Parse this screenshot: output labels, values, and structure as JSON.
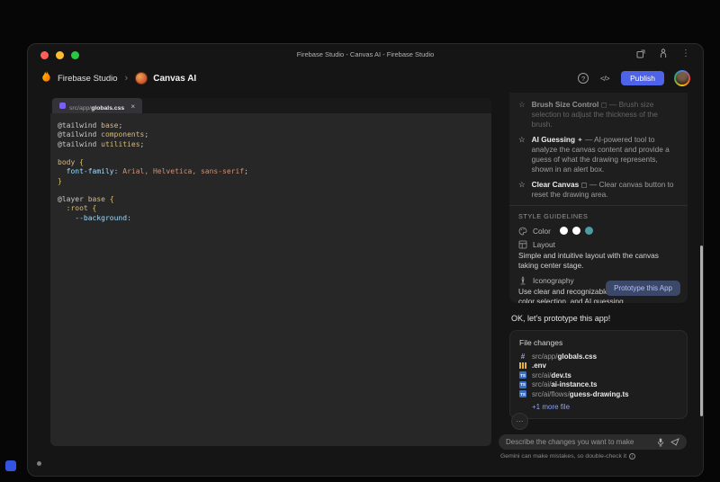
{
  "window": {
    "title": "Firebase Studio - Canvas AI - Firebase Studio",
    "traffic_lights": [
      "#ff5f57",
      "#febc2e",
      "#28c840"
    ]
  },
  "icons": {
    "chevron": "›",
    "kebab": "⋮",
    "help": "?",
    "code": "</>",
    "close": "×",
    "more": "⋯",
    "info": "i",
    "star": "☆"
  },
  "header": {
    "brand": "Firebase Studio",
    "app_name": "Canvas AI",
    "publish_label": "Publish",
    "accent_color": "#4e63e8"
  },
  "editor": {
    "tab": {
      "path": "src/app/",
      "file": "globals.css"
    },
    "code_lines": [
      [
        {
          "t": "@tailwind",
          "c": "#c8c8c8"
        },
        {
          "t": " base",
          "c": "#d7ba7d"
        },
        {
          "t": ";",
          "c": "#c8c8c8"
        }
      ],
      [
        {
          "t": "@tailwind",
          "c": "#c8c8c8"
        },
        {
          "t": " components",
          "c": "#d7ba7d"
        },
        {
          "t": ";",
          "c": "#c8c8c8"
        }
      ],
      [
        {
          "t": "@tailwind",
          "c": "#c8c8c8"
        },
        {
          "t": " utilities",
          "c": "#d7ba7d"
        },
        {
          "t": ";",
          "c": "#c8c8c8"
        }
      ],
      [],
      [
        {
          "t": "body ",
          "c": "#d7ba7d"
        },
        {
          "t": "{",
          "c": "#e2c064"
        }
      ],
      [
        {
          "t": "  font-family",
          "c": "#9cdcfe"
        },
        {
          "t": ":",
          "c": "#c8c8c8"
        },
        {
          "t": " Arial, Helvetica, sans-serif",
          "c": "#ce9178"
        },
        {
          "t": ";",
          "c": "#c8c8c8"
        }
      ],
      [
        {
          "t": "}",
          "c": "#e2c064"
        }
      ],
      [],
      [
        {
          "t": "@layer",
          "c": "#c8c8c8"
        },
        {
          "t": " base ",
          "c": "#d7ba7d"
        },
        {
          "t": "{",
          "c": "#e2c064"
        }
      ],
      [
        {
          "t": "  :root ",
          "c": "#d7ba7d"
        },
        {
          "t": "{",
          "c": "#e2c064"
        }
      ],
      [
        {
          "t": "    --background",
          "c": "#9cdcfe"
        },
        {
          "t": ":",
          "c": "#c8c8c8"
        }
      ]
    ]
  },
  "chat": {
    "features": [
      {
        "name": "Brush Size Control",
        "glyph": "▢",
        "desc": "— Brush size selection to adjust the thickness of the brush."
      },
      {
        "name": "AI Guessing",
        "glyph": "✦",
        "desc": "— AI-powered tool to analyze the canvas content and provide a guess of what the drawing represents, shown in an alert box."
      },
      {
        "name": "Clear Canvas",
        "glyph": "▢",
        "desc": "— Clear canvas button to reset the drawing area."
      }
    ],
    "style_guidelines": {
      "heading": "STYLE GUIDELINES",
      "color_label": "Color",
      "colors": [
        "#ffffff",
        "#ffffff",
        "#4f9ba0"
      ],
      "layout_label": "Layout",
      "layout_text": "Simple and intuitive layout with the canvas taking center stage.",
      "iconography_label": "Iconography",
      "iconography_text": "Use clear and recognizable icons for brush size, color selection, and AI guessing."
    },
    "prototype_button": "Prototype this App",
    "message": "OK, let's prototype this app!",
    "file_changes": {
      "title": "File changes",
      "files": [
        {
          "type": "css",
          "badge": "#",
          "path": "src/app/",
          "file": "globals.css"
        },
        {
          "type": "env",
          "badge": "",
          "path": "",
          "file": ".env"
        },
        {
          "type": "ts",
          "badge": "TS",
          "path": "src/ai/",
          "file": "dev.ts"
        },
        {
          "type": "ts",
          "badge": "TS",
          "path": "src/ai/",
          "file": "ai-instance.ts"
        },
        {
          "type": "ts",
          "badge": "TS",
          "path": "src/ai/flows/",
          "file": "guess-drawing.ts"
        }
      ],
      "more_link": "+1 more file"
    },
    "input": {
      "placeholder": "Describe the changes you want to make"
    },
    "footer_note": "Gemini can make mistakes, so double-check it"
  }
}
